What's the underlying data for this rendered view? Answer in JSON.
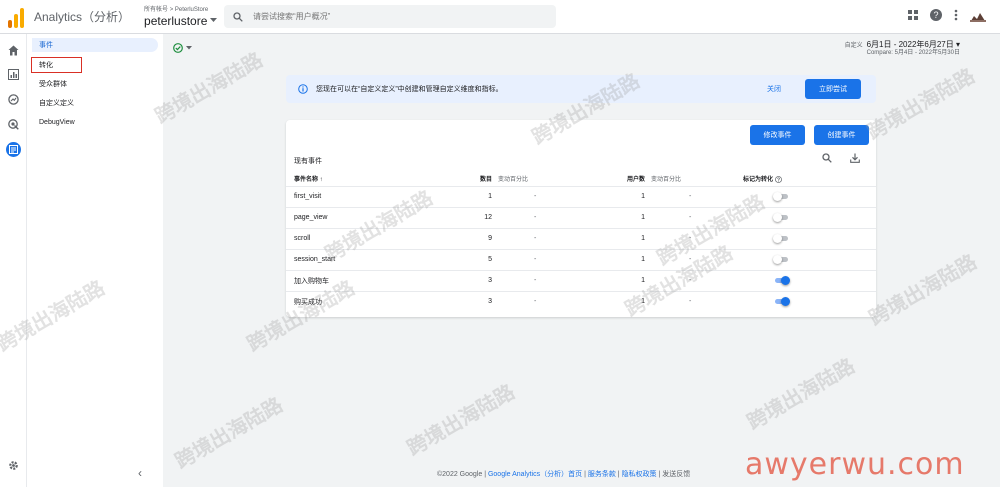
{
  "header": {
    "app_title": "Analytics（分析）",
    "breadcrumb": "所有帐号 > PeterluStore",
    "property": "peterlustore",
    "search_placeholder": "请尝试搜索“用户概况”"
  },
  "subnav": {
    "items": [
      {
        "label": "事件"
      },
      {
        "label": "转化"
      },
      {
        "label": "受众群体"
      },
      {
        "label": "自定义定义"
      },
      {
        "label": "DebugView"
      }
    ]
  },
  "date_range": {
    "label": "自定义",
    "primary": "6月1日 - 2022年6月27日",
    "compare": "Compare: 5月4日 - 2022年5月30日"
  },
  "banner": {
    "text": "您现在可以在“自定义定义”中创建和管理自定义维度和指标。",
    "close_label": "关闭",
    "try_label": "立即尝试"
  },
  "card": {
    "modify_label": "修改事件",
    "create_label": "创建事件",
    "title": "现有事件",
    "columns": {
      "name": "事件名称 ↑",
      "count": "数目",
      "count_change": "变动百分比",
      "users": "用户数",
      "users_change": "变动百分比",
      "conversion": "标记为转化"
    },
    "rows": [
      {
        "name": "first_visit",
        "count": "1",
        "count_change": "-",
        "users": "1",
        "users_change": "-",
        "conversion": false
      },
      {
        "name": "page_view",
        "count": "12",
        "count_change": "-",
        "users": "1",
        "users_change": "-",
        "conversion": false
      },
      {
        "name": "scroll",
        "count": "9",
        "count_change": "-",
        "users": "1",
        "users_change": "-",
        "conversion": false
      },
      {
        "name": "session_start",
        "count": "5",
        "count_change": "-",
        "users": "1",
        "users_change": "-",
        "conversion": false
      },
      {
        "name": "加入购物车",
        "count": "3",
        "count_change": "-",
        "users": "1",
        "users_change": "-",
        "conversion": true
      },
      {
        "name": "购买成功",
        "count": "3",
        "count_change": "-",
        "users": "1",
        "users_change": "-",
        "conversion": true
      }
    ]
  },
  "footer": {
    "copyright": "©2022 Google",
    "links": [
      "Google Analytics（分析）首页",
      "服务条款",
      "隐私权政策"
    ],
    "feedback": "发送反馈"
  },
  "watermarks": {
    "cn": "跨境出海陆路",
    "brand": "awyerwu.com"
  }
}
